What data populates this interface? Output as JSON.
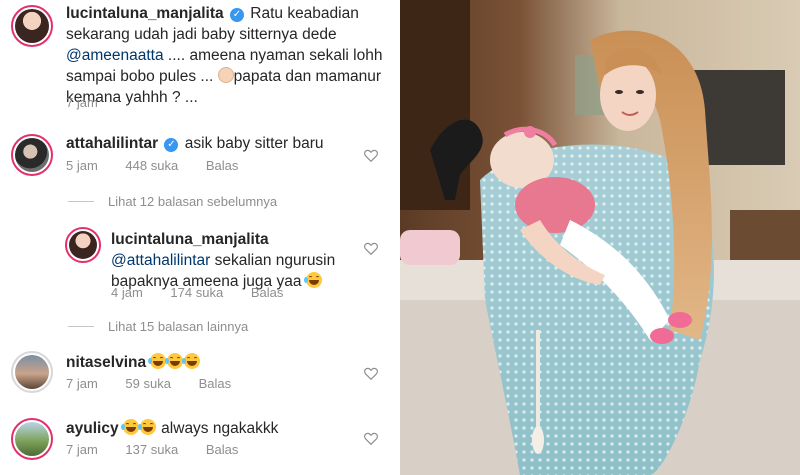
{
  "comments": {
    "main": {
      "username": "lucintaluna_manjalita",
      "text_before_mention": "Ratu keabadian sekarang udah jadi baby sitternya dede ",
      "mention": "@ameenaatta",
      "text_after_mention": " .... ameena nyaman sekali lohh sampai bobo pules ... ",
      "text_end": "papata dan mamanur kemana yahhh ? ...",
      "time": "7 jam"
    },
    "c1": {
      "username": "attahalilintar",
      "text": "asik baby sitter baru",
      "time": "5 jam",
      "likes": "448 suka",
      "reply": "Balas"
    },
    "view_prev": "Lihat 12 balasan sebelumnya",
    "reply1": {
      "username": "lucintaluna_manjalita",
      "mention": "@attahalilintar",
      "text": " sekalian ngurusin bapaknya ameena juga yaa",
      "time": "4 jam",
      "likes": "174 suka",
      "reply": "Balas"
    },
    "view_more": "Lihat 15 balasan lainnya",
    "c2": {
      "username": "nitaselvina",
      "time": "7 jam",
      "likes": "59 suka",
      "reply": "Balas"
    },
    "c3": {
      "username": "ayulicy",
      "text": " always ngakakkk",
      "time": "7 jam",
      "likes": "137 suka",
      "reply": "Balas"
    }
  },
  "icons": {
    "verified": "verified-badge-icon",
    "heart": "heart-outline-icon",
    "emoji": "tears-of-joy-emoji",
    "baby": "baby-emoji"
  },
  "colors": {
    "username": "#262626",
    "mention": "#00376b",
    "meta": "#8e8e8e",
    "verified": "#3897f0",
    "story_ring": "#e1306c"
  }
}
